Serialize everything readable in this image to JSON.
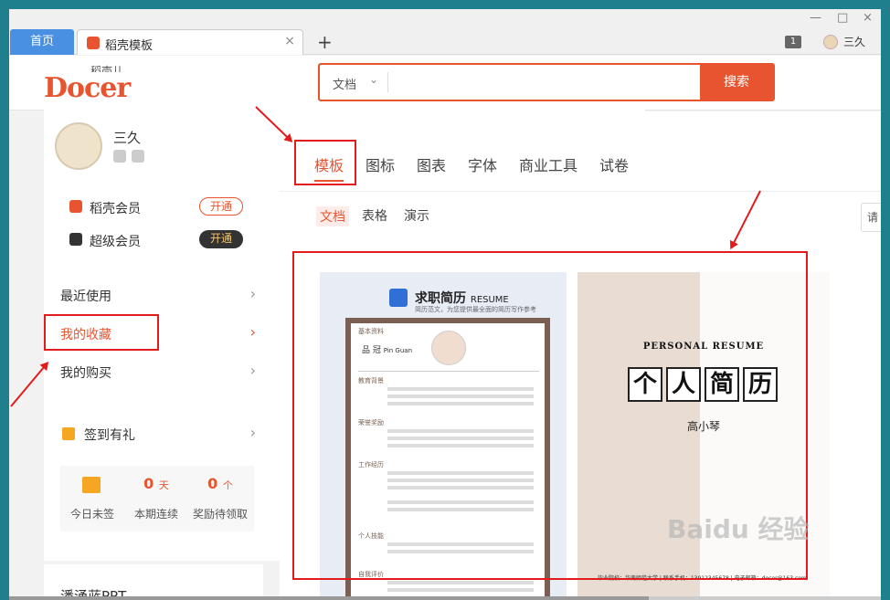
{
  "tabs": {
    "home": "首页",
    "active_title": "稻壳模板",
    "add": "+",
    "close": "×"
  },
  "window_controls": {
    "minimize": "—",
    "maximize": "□",
    "close": "×"
  },
  "top_right": {
    "badge": "1",
    "username": "三久"
  },
  "brand": {
    "sub": "稻壳儿",
    "main": "Docer"
  },
  "search": {
    "type": "文档",
    "placeholder": "",
    "button": "搜索"
  },
  "sidebar": {
    "username": "三久",
    "members": [
      {
        "label": "稻壳会员",
        "button": "开通",
        "color": "#e8542f"
      },
      {
        "label": "超级会员",
        "button": "开通",
        "color": "#333333"
      }
    ],
    "menu": [
      {
        "label": "最近使用"
      },
      {
        "label": "我的收藏"
      },
      {
        "label": "我的购买"
      }
    ],
    "checkin": {
      "title": "签到有礼",
      "stats": [
        {
          "value": "",
          "unit": "",
          "label": "今日未签"
        },
        {
          "value": "0",
          "unit": "天",
          "label": "本期连续"
        },
        {
          "value": "0",
          "unit": "个",
          "label": "奖励待领取"
        }
      ]
    },
    "ppt_label": "潘涌蓝PPT"
  },
  "main": {
    "categories": [
      "模板",
      "图标",
      "图表",
      "字体",
      "商业工具",
      "试卷"
    ],
    "subtabs": [
      "文档",
      "表格",
      "演示"
    ],
    "right_fragment": "请",
    "templates": [
      {
        "title": "求职简历",
        "title_en": "RESUME",
        "subtitle": "简历范文，为您提供最全面的简历写作参考",
        "person_name": "品 冠",
        "person_name_en": "Pin Guan",
        "sections": [
          "基本资料",
          "教育背景",
          "荣誉奖励",
          "工作经历",
          "个人技能",
          "自我评价"
        ]
      },
      {
        "title_en": "PERSONAL RESUME",
        "title_chars": [
          "个",
          "人",
          "简",
          "历"
        ],
        "name": "高小琴",
        "footer": "毕业院校：华南师范大学  |  联系手机：13912345678  |  电子邮箱：docer@163.com"
      }
    ]
  },
  "watermark": "Baidu 经验"
}
